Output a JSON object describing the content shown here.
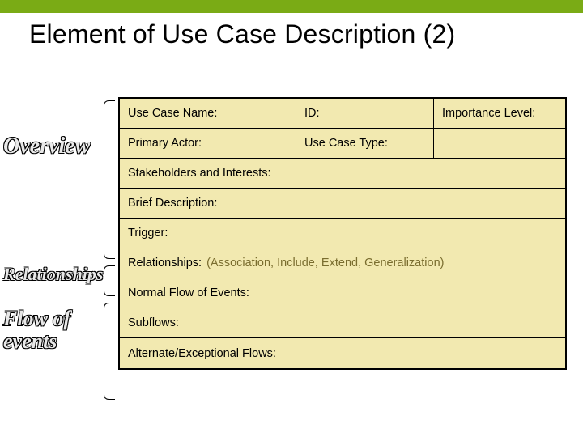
{
  "title": "Element of Use Case Description (2)",
  "sideLabels": {
    "overview": "Overview",
    "relationships": "Relationships",
    "flow_line1": "Flow of",
    "flow_line2": "events"
  },
  "rows": {
    "r1": {
      "useCaseName": "Use Case Name:",
      "id": "ID:",
      "importance": "Importance Level:"
    },
    "r2": {
      "primaryActor": "Primary Actor:",
      "useCaseType": "Use Case Type:"
    },
    "r3": {
      "stakeholders": "Stakeholders and Interests:"
    },
    "r4": {
      "briefDesc": "Brief Description:"
    },
    "r5": {
      "trigger": "Trigger:"
    },
    "r6": {
      "relationships": "Relationships:",
      "detail": "(Association, Include, Extend, Generalization)"
    },
    "r7": {
      "normalFlow": "Normal Flow of Events:"
    },
    "r8": {
      "subflows": "Subflows:"
    },
    "r9": {
      "altFlows": "Alternate/Exceptional Flows:"
    }
  }
}
